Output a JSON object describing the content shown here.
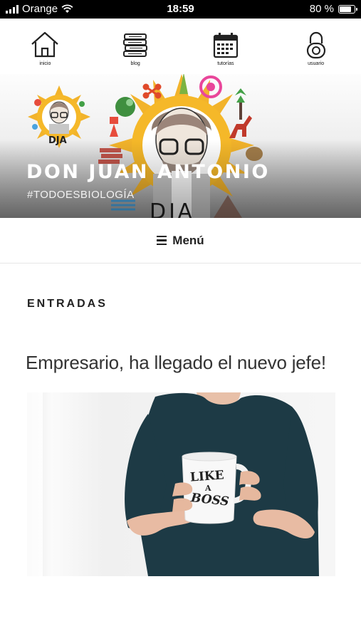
{
  "status_bar": {
    "carrier": "Orange",
    "time": "18:59",
    "battery": "80 %"
  },
  "nav": {
    "items": [
      {
        "label": "inicio",
        "icon": "home-icon"
      },
      {
        "label": "blog",
        "icon": "books-icon"
      },
      {
        "label": "tutorías",
        "icon": "calendar-icon"
      },
      {
        "label": "usuario",
        "icon": "lock-icon"
      }
    ]
  },
  "hero": {
    "title": "DON JUAN ANTONIO",
    "description": "#TODOESBIOLOGÍA",
    "logo_text": "DJA"
  },
  "menu": {
    "label": "Menú"
  },
  "main": {
    "section_title": "ENTRADAS",
    "post": {
      "title": "Empresario, ha llegado el nuevo jefe!",
      "mug_text": [
        "LIKE",
        "A",
        "BOSS"
      ]
    }
  },
  "colors": {
    "accent_sun": "#f2b32b",
    "title_text": "#ffffff",
    "body_text": "#333333"
  }
}
